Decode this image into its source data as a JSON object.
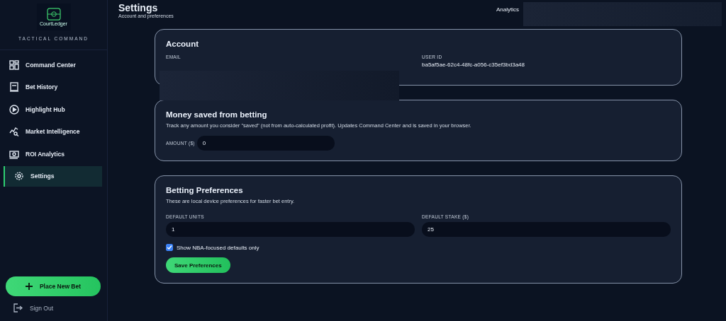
{
  "sidebar": {
    "logo_text": "CourtLedger",
    "subtitle": "TACTICAL COMMAND",
    "items": [
      {
        "label": "Command Center",
        "selected": false
      },
      {
        "label": "Bet History",
        "selected": false
      },
      {
        "label": "Highlight Hub",
        "selected": false
      },
      {
        "label": "Market Intelligence",
        "selected": false
      },
      {
        "label": "ROI Analytics",
        "selected": false
      },
      {
        "label": "Settings",
        "selected": true
      }
    ],
    "cta": "Place New Bet",
    "sign_out": "Sign Out"
  },
  "header": {
    "title": "Settings",
    "subtitle": "Account and preferences",
    "right_label": "Analytics"
  },
  "account": {
    "title": "Account",
    "email_label": "EMAIL",
    "user_id_label": "USER ID",
    "user_id": "ba5af5ae-62c4-48fc-a056-c35ef3bd3a48"
  },
  "money_saved": {
    "title": "Money saved from betting",
    "description": "Track any amount you consider \"saved\" (not from auto-calculated profit). Updates Command Center and is saved in your browser.",
    "amount_label": "AMOUNT ($)",
    "amount_value": "0"
  },
  "preferences": {
    "title": "Betting Preferences",
    "description": "These are local device preferences for faster bet entry.",
    "units_label": "DEFAULT UNITS",
    "units_value": "1",
    "stake_label": "DEFAULT STAKE ($)",
    "stake_value": "25",
    "nba_only": {
      "label": "Show NBA-focused defaults only",
      "checked": true
    },
    "save_button": "Save Preferences"
  }
}
